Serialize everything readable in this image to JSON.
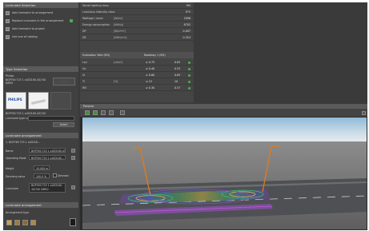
{
  "left": {
    "luminaire_selection": {
      "title": "Luminaire Selection",
      "buttons": [
        {
          "label": "Add luminaire to arrangement",
          "icon": "add-luminaire-icon"
        },
        {
          "label": "Replace luminaire in the arrangement",
          "icon": "replace-luminaire-icon"
        },
        {
          "label": "Add luminaire to project",
          "icon": "add-project-icon"
        },
        {
          "label": "Use one of catalog",
          "icon": "catalog-icon"
        }
      ]
    },
    "type_selection": {
      "title": "Type Selection",
      "item_name": "Philips",
      "item_desc": "BGP760 T25 1 xLED160-4S/740 DM50",
      "logo": "PHILIPS",
      "caption": "BGP760 T25 1 xLED160-4S/740",
      "search_label": "Luminaire type code",
      "select_label": "Select"
    },
    "arrangement": {
      "title": "Luminaire arrangement",
      "group": "1. BGP760 T25 1 xLED16...",
      "fields": [
        {
          "label": "Name",
          "value": "BGP760 T25 1 xLED160-4S/..."
        },
        {
          "label": "Operating Mode",
          "value": "BGP760 T25 1 xLED160..."
        },
        {
          "label": "Height",
          "value": "10.000 m"
        },
        {
          "label": "Dimming value",
          "value": "100.0 %"
        },
        {
          "label": "Luminaire",
          "value": "BGP760 T25 1 xLED160-4S/740 DM50"
        }
      ],
      "dimming_checkbox": "Dimmed"
    },
    "luminaire_arrangement": {
      "title": "Luminaire arrangement",
      "subtitle": "Arrangement type"
    }
  },
  "table": {
    "rows": [
      {
        "key": "Street lighting class",
        "unit": "",
        "value": "M4"
      },
      {
        "key": "Luminous intensity class",
        "unit": "",
        "value": "G*3"
      },
      {
        "key": "Wattage / route",
        "unit": "[W/km]",
        "value": "2096"
      },
      {
        "key": "Energy consumption",
        "unit": "[kWh/a]",
        "value": "8702"
      },
      {
        "key": "DP",
        "unit": "[W/lx*m²]",
        "value": "0.097"
      },
      {
        "key": "DE",
        "unit": "[kWh/m²a]",
        "value": "0.324"
      }
    ],
    "subhead": {
      "left": "Evaluation field (M4)",
      "right": "Roadway 1 (M4)"
    },
    "eval_rows": [
      {
        "key": "Lav",
        "unit": "[cd/m²]",
        "req": "≥ 0.75",
        "actual": "0.82"
      },
      {
        "key": "Uo",
        "unit": "",
        "req": "≥ 0.40",
        "actual": "0.53"
      },
      {
        "key": "Ul",
        "unit": "",
        "req": "≥ 0.60",
        "actual": "0.65"
      },
      {
        "key": "TI",
        "unit": "[%]",
        "req": "≤ 15",
        "actual": "10"
      },
      {
        "key": "REI",
        "unit": "",
        "req": "≥ 0.30",
        "actual": "0.57"
      }
    ]
  },
  "preview": {
    "title": "Preview",
    "tools": [
      "3d-view-icon",
      "plan-view-icon",
      "zoom-icon",
      "fit-icon"
    ]
  },
  "colors": {
    "pole": "#e07b1c",
    "check": "#4caf50",
    "road": "#4f5054",
    "sky_top": "#8fb9d8"
  }
}
